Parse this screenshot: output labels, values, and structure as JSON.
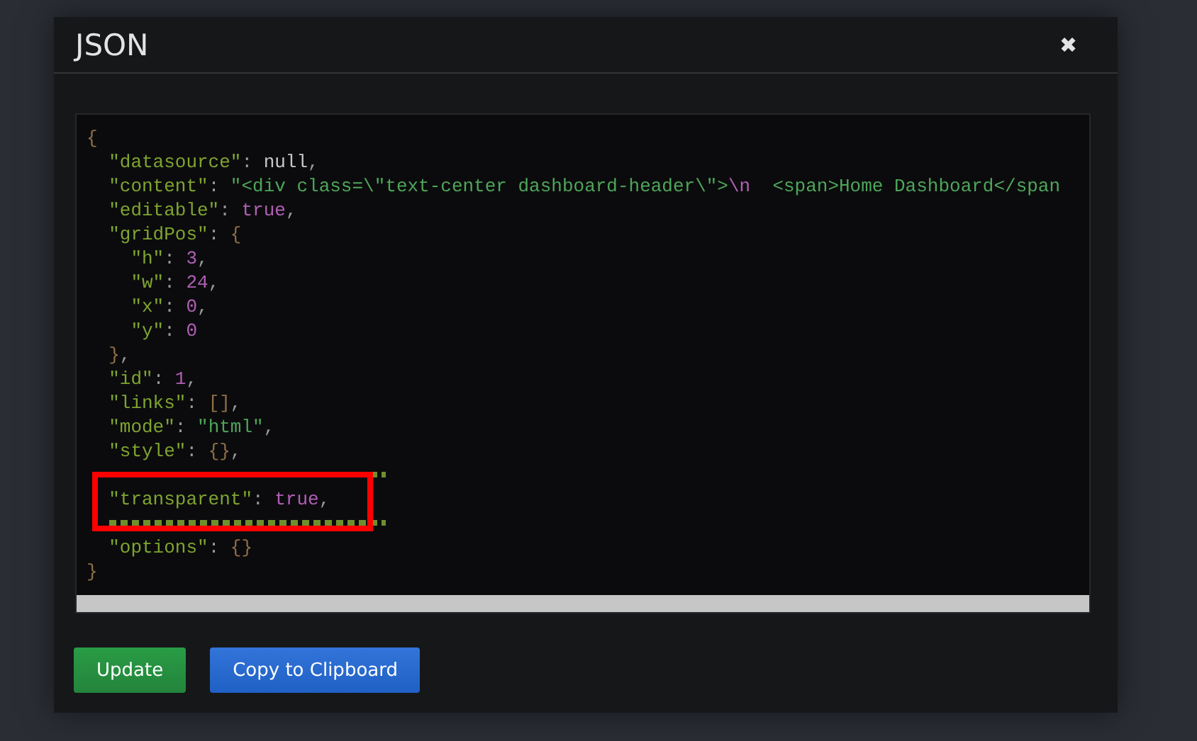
{
  "dialog": {
    "title": "JSON",
    "close": "✖"
  },
  "code_lines": [
    {
      "tokens": [
        {
          "kind": "brace",
          "text": "{"
        }
      ],
      "children": [
        {
          "tokens": [
            {
              "kind": "key",
              "text": "\"datasource\""
            },
            {
              "kind": "punct",
              "text": ": "
            },
            {
              "kind": "null",
              "text": "null"
            },
            {
              "kind": "punct",
              "text": ","
            }
          ]
        },
        {
          "tokens": [
            {
              "kind": "key",
              "text": "\"content\""
            },
            {
              "kind": "punct",
              "text": ": "
            },
            {
              "kind": "string",
              "text": "\"<div class=\\\"text-center dashboard-header\\\">"
            },
            {
              "kind": "escape",
              "text": "\\n"
            },
            {
              "kind": "string",
              "text": "  <span>Home Dashboard</span"
            }
          ]
        },
        {
          "tokens": [
            {
              "kind": "key",
              "text": "\"editable\""
            },
            {
              "kind": "punct",
              "text": ": "
            },
            {
              "kind": "number",
              "text": "true"
            },
            {
              "kind": "punct",
              "text": ","
            }
          ]
        },
        {
          "tokens": [
            {
              "kind": "key",
              "text": "\"gridPos\""
            },
            {
              "kind": "punct",
              "text": ": "
            },
            {
              "kind": "brace",
              "text": "{"
            }
          ],
          "children": [
            {
              "tokens": [
                {
                  "kind": "key",
                  "text": "\"h\""
                },
                {
                  "kind": "punct",
                  "text": ": "
                },
                {
                  "kind": "number",
                  "text": "3"
                },
                {
                  "kind": "punct",
                  "text": ","
                }
              ]
            },
            {
              "tokens": [
                {
                  "kind": "key",
                  "text": "\"w\""
                },
                {
                  "kind": "punct",
                  "text": ": "
                },
                {
                  "kind": "number",
                  "text": "24"
                },
                {
                  "kind": "punct",
                  "text": ","
                }
              ]
            },
            {
              "tokens": [
                {
                  "kind": "key",
                  "text": "\"x\""
                },
                {
                  "kind": "punct",
                  "text": ": "
                },
                {
                  "kind": "number",
                  "text": "0"
                },
                {
                  "kind": "punct",
                  "text": ","
                }
              ]
            },
            {
              "tokens": [
                {
                  "kind": "key",
                  "text": "\"y\""
                },
                {
                  "kind": "punct",
                  "text": ": "
                },
                {
                  "kind": "number",
                  "text": "0"
                }
              ]
            }
          ]
        },
        {
          "tokens": [
            {
              "kind": "brace",
              "text": "}"
            },
            {
              "kind": "punct",
              "text": ","
            }
          ]
        },
        {
          "tokens": [
            {
              "kind": "key",
              "text": "\"id\""
            },
            {
              "kind": "punct",
              "text": ": "
            },
            {
              "kind": "number",
              "text": "1"
            },
            {
              "kind": "punct",
              "text": ","
            }
          ]
        },
        {
          "tokens": [
            {
              "kind": "key",
              "text": "\"links\""
            },
            {
              "kind": "punct",
              "text": ": "
            },
            {
              "kind": "brace",
              "text": "[]"
            },
            {
              "kind": "punct",
              "text": ","
            }
          ]
        },
        {
          "tokens": [
            {
              "kind": "key",
              "text": "\"mode\""
            },
            {
              "kind": "punct",
              "text": ": "
            },
            {
              "kind": "string",
              "text": "\"html\""
            },
            {
              "kind": "punct",
              "text": ","
            }
          ]
        },
        {
          "tokens": [
            {
              "kind": "key",
              "text": "\"style\""
            },
            {
              "kind": "punct",
              "text": ": "
            },
            {
              "kind": "brace",
              "text": "{}"
            },
            {
              "kind": "punct",
              "text": ","
            }
          ]
        },
        {
          "covered": true
        },
        {
          "tokens": [
            {
              "kind": "key",
              "text": "\"transparent\""
            },
            {
              "kind": "punct",
              "text": ": "
            },
            {
              "kind": "number",
              "text": "true"
            },
            {
              "kind": "punct",
              "text": ","
            }
          ]
        },
        {
          "covered": true
        },
        {
          "tokens": [
            {
              "kind": "key",
              "text": "\"options\""
            },
            {
              "kind": "punct",
              "text": ": "
            },
            {
              "kind": "brace",
              "text": "{}"
            }
          ]
        }
      ]
    },
    {
      "tokens": [
        {
          "kind": "brace",
          "text": "}"
        }
      ]
    }
  ],
  "buttons": [
    {
      "kind": "primary",
      "label": "Update"
    },
    {
      "kind": "secondary",
      "label": "Copy to Clipboard"
    }
  ]
}
